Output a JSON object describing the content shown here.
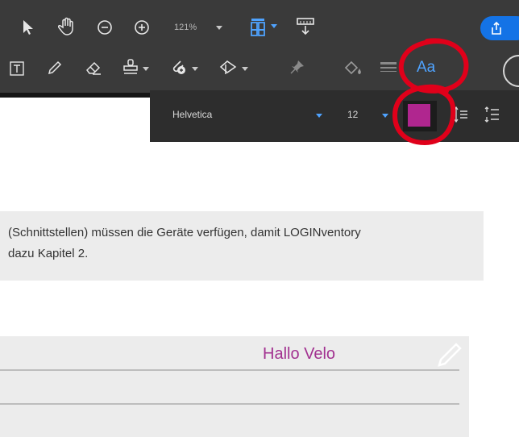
{
  "toolbar_top": {
    "zoom": "121%",
    "icons": [
      "select-pointer-icon",
      "hand-tool-icon",
      "zoom-out-icon",
      "zoom-in-icon",
      "fit-page-icon",
      "scroll-mode-icon",
      "share-icon"
    ]
  },
  "toolbar_second": {
    "text_properties_label": "Aa",
    "icons": [
      "text-box-icon",
      "pencil-icon",
      "eraser-icon",
      "stamp-icon",
      "attach-icon",
      "shape-icon",
      "pin-icon",
      "fill-color-icon",
      "line-weight-icon"
    ]
  },
  "text_properties": {
    "font": "Helvetica",
    "size": "12",
    "color": "#b0268f"
  },
  "document": {
    "line1": "(Schnittstellen) müssen die Geräte verfügen, damit LOGINventory",
    "line2": "dazu Kapitel 2."
  },
  "form": {
    "text": "Hallo Velo"
  },
  "colors": {
    "toolbar": "#3a3a3a",
    "accent": "#1473e6",
    "annotation": "#e0001a",
    "text_color": "#a23190"
  }
}
